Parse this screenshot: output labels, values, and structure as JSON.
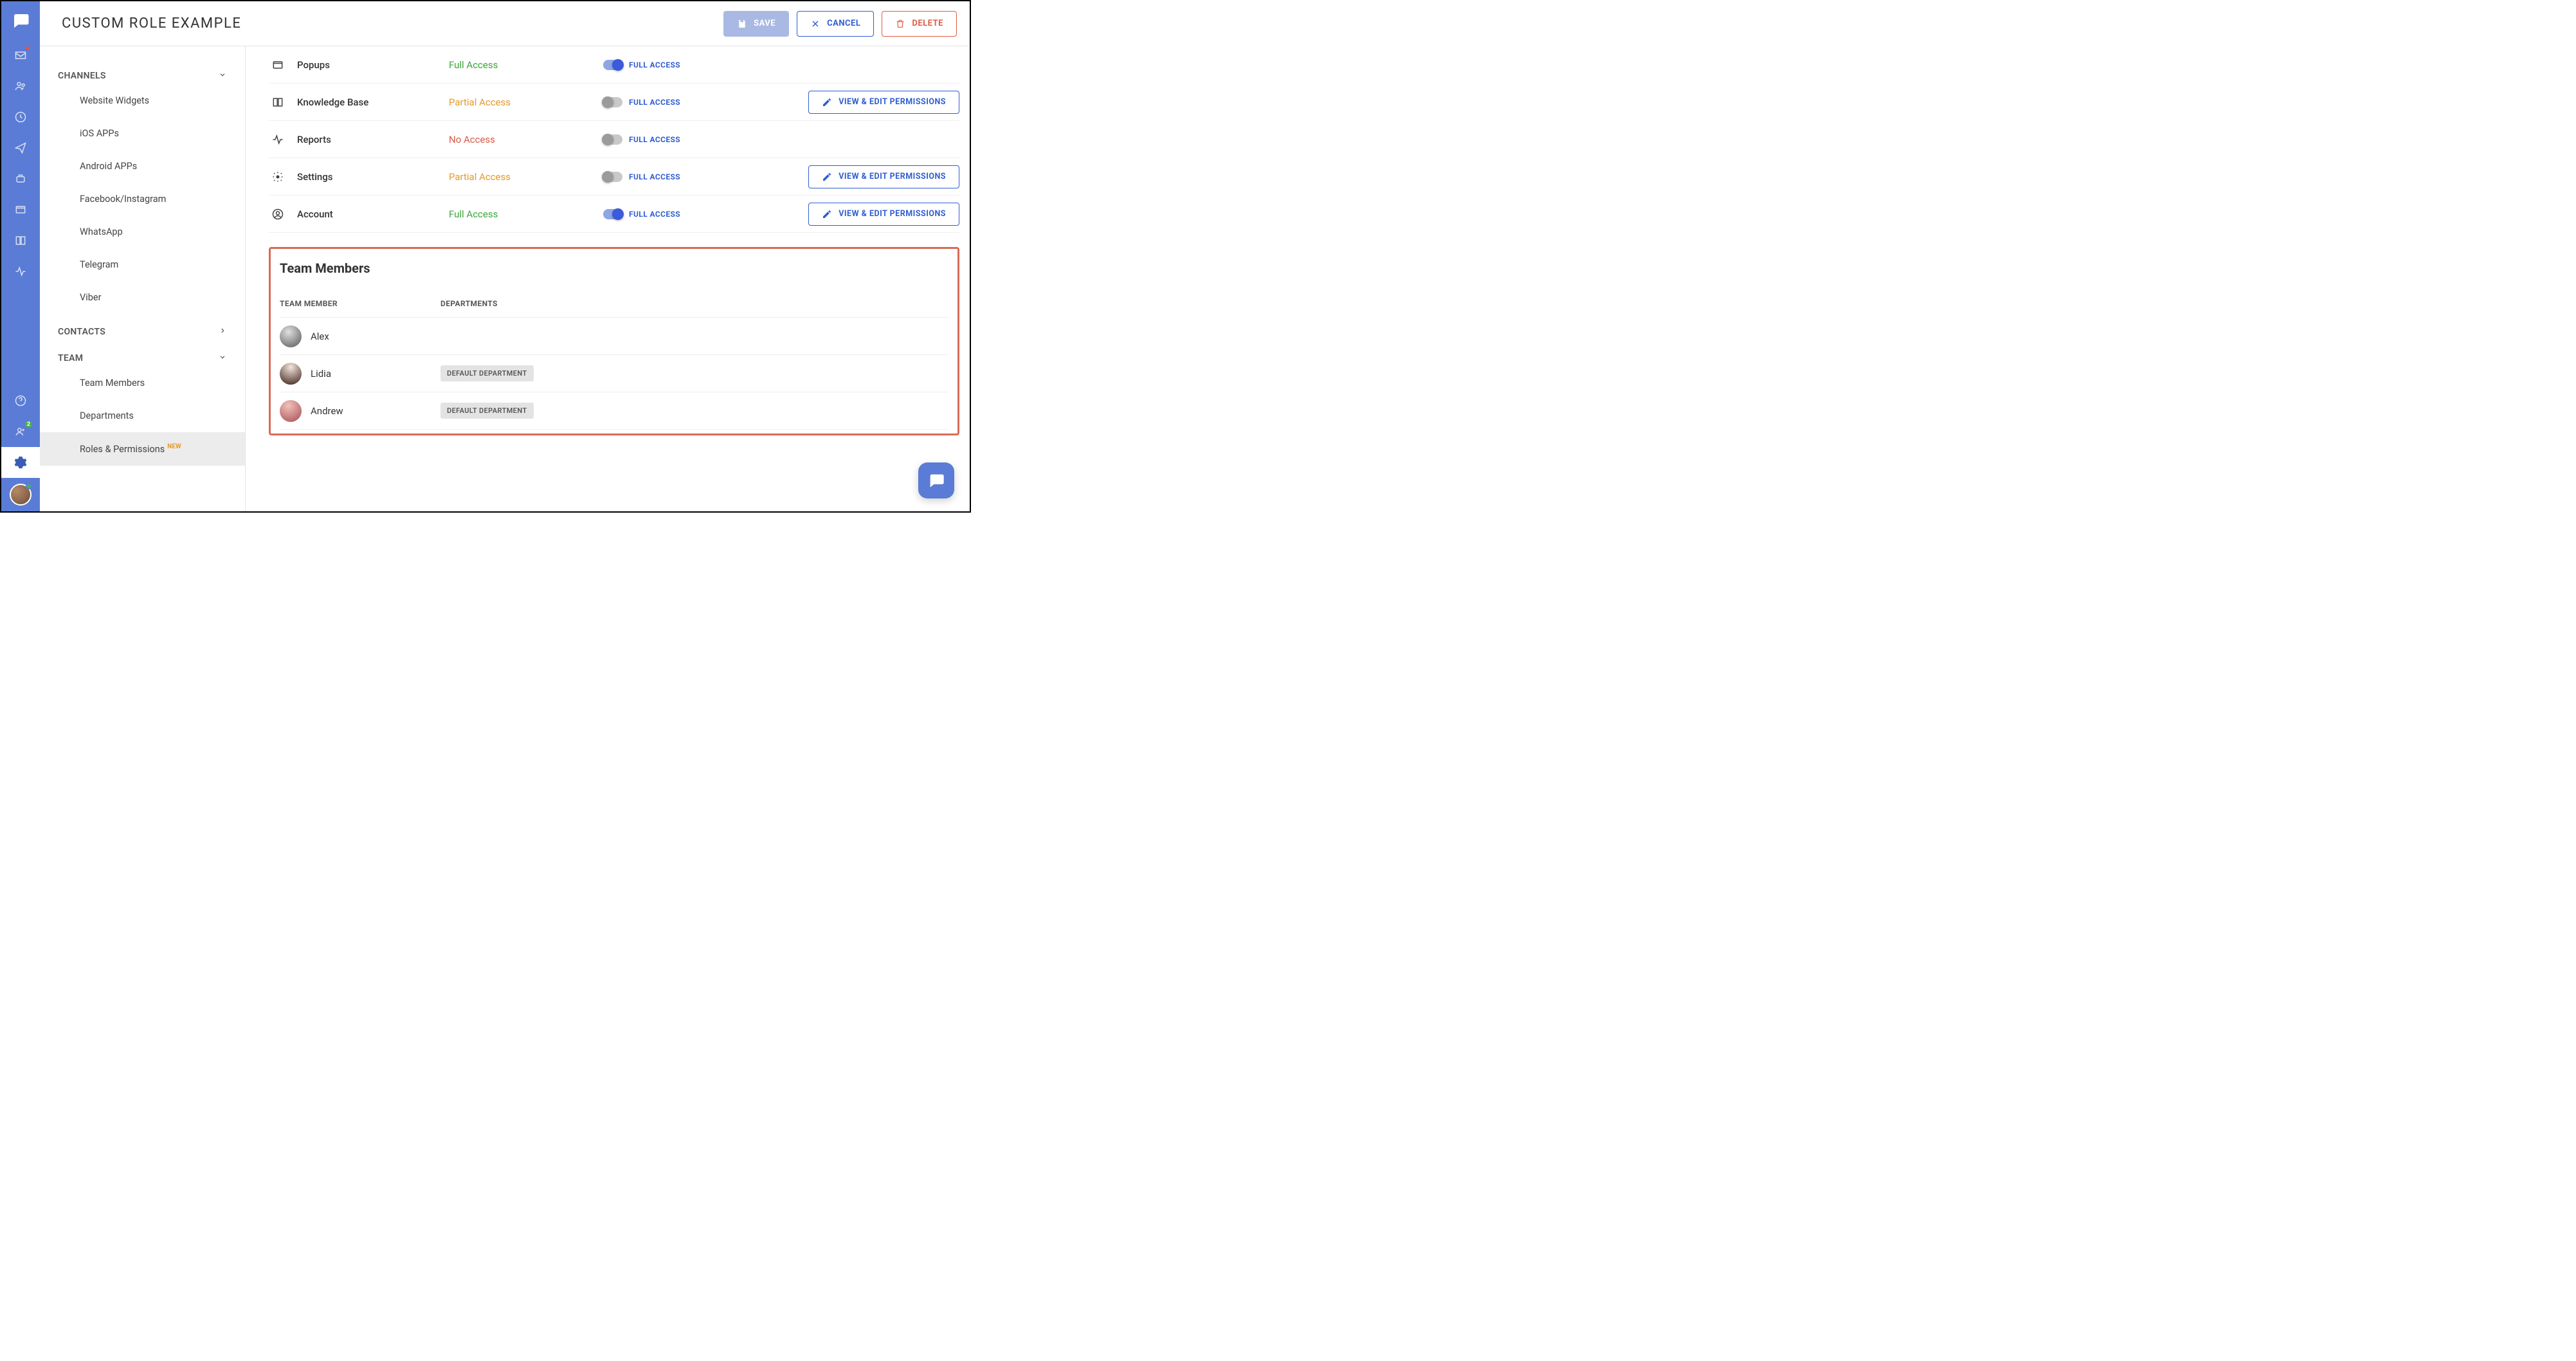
{
  "page_title": "CUSTOM ROLE EXAMPLE",
  "actions": {
    "save": "SAVE",
    "cancel": "CANCEL",
    "delete": "DELETE"
  },
  "rail": {
    "inbox_badge": "",
    "team_badge": "2"
  },
  "sidebar": {
    "channels": {
      "label": "CHANNELS",
      "items": [
        "Website Widgets",
        "iOS APPs",
        "Android APPs",
        "Facebook/Instagram",
        "WhatsApp",
        "Telegram",
        "Viber"
      ]
    },
    "contacts": {
      "label": "CONTACTS"
    },
    "team": {
      "label": "TEAM",
      "items": [
        {
          "label": "Team Members"
        },
        {
          "label": "Departments"
        },
        {
          "label": "Roles & Permissions",
          "tag": "NEW"
        }
      ]
    }
  },
  "permissions": {
    "toggle_label": "FULL ACCESS",
    "view_edit": "VIEW & EDIT PERMISSIONS",
    "rows": [
      {
        "name": "Popups",
        "access": "Full Access",
        "access_class": "full",
        "on": true,
        "has_action": false
      },
      {
        "name": "Knowledge Base",
        "access": "Partial Access",
        "access_class": "partial",
        "on": false,
        "has_action": true
      },
      {
        "name": "Reports",
        "access": "No Access",
        "access_class": "none",
        "on": false,
        "has_action": false
      },
      {
        "name": "Settings",
        "access": "Partial Access",
        "access_class": "partial",
        "on": false,
        "has_action": true
      },
      {
        "name": "Account",
        "access": "Full Access",
        "access_class": "full",
        "on": true,
        "has_action": true
      }
    ]
  },
  "team_members": {
    "title": "Team Members",
    "col_member": "TEAM MEMBER",
    "col_dept": "DEPARTMENTS",
    "dept_tag": "DEFAULT DEPARTMENT",
    "rows": [
      {
        "name": "Alex",
        "dept": false
      },
      {
        "name": "Lidia",
        "dept": true
      },
      {
        "name": "Andrew",
        "dept": true
      }
    ]
  }
}
